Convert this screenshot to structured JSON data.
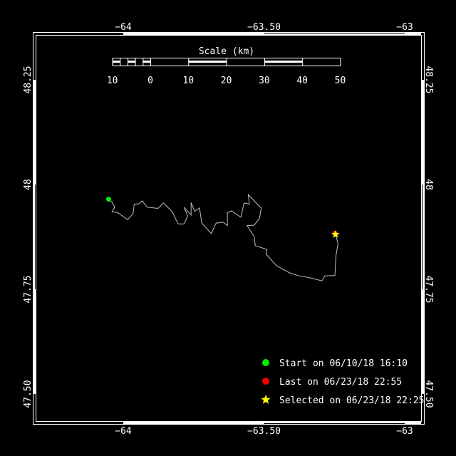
{
  "chart_data": {
    "type": "map-track",
    "lon_ticks": [
      -64,
      -63.5,
      -63
    ],
    "lon_tick_labels": [
      "−64",
      "−63.50",
      "−63"
    ],
    "lat_ticks": [
      48.25,
      48,
      47.75,
      47.5
    ],
    "lat_tick_labels": [
      "48.25",
      "48",
      "47.75",
      "47.50"
    ],
    "scale_bar": {
      "title": "Scale (km)",
      "ticks": [
        -10,
        0,
        10,
        20,
        30,
        40,
        50
      ],
      "tick_labels": [
        "10",
        "0",
        "10",
        "20",
        "30",
        "40",
        "50"
      ]
    },
    "track": {
      "color": "#c0c0c0",
      "points": [
        [
          -64.052,
          47.965
        ],
        [
          -64.041,
          47.959
        ],
        [
          -64.03,
          47.946
        ],
        [
          -64.04,
          47.935
        ],
        [
          -64.02,
          47.933
        ],
        [
          -63.984,
          47.916
        ],
        [
          -63.965,
          47.931
        ],
        [
          -63.961,
          47.953
        ],
        [
          -63.944,
          47.954
        ],
        [
          -63.933,
          47.961
        ],
        [
          -63.915,
          47.946
        ],
        [
          -63.877,
          47.943
        ],
        [
          -63.857,
          47.956
        ],
        [
          -63.826,
          47.935
        ],
        [
          -63.805,
          47.906
        ],
        [
          -63.784,
          47.906
        ],
        [
          -63.771,
          47.925
        ],
        [
          -63.784,
          47.946
        ],
        [
          -63.759,
          47.927
        ],
        [
          -63.759,
          47.957
        ],
        [
          -63.746,
          47.936
        ],
        [
          -63.729,
          47.944
        ],
        [
          -63.721,
          47.908
        ],
        [
          -63.687,
          47.883
        ],
        [
          -63.67,
          47.908
        ],
        [
          -63.645,
          47.91
        ],
        [
          -63.63,
          47.902
        ],
        [
          -63.63,
          47.933
        ],
        [
          -63.615,
          47.937
        ],
        [
          -63.582,
          47.922
        ],
        [
          -63.571,
          47.956
        ],
        [
          -63.552,
          47.953
        ],
        [
          -63.556,
          47.976
        ],
        [
          -63.535,
          47.961
        ],
        [
          -63.51,
          47.944
        ],
        [
          -63.516,
          47.919
        ],
        [
          -63.535,
          47.903
        ],
        [
          -63.56,
          47.902
        ],
        [
          -63.535,
          47.876
        ],
        [
          -63.531,
          47.854
        ],
        [
          -63.489,
          47.845
        ],
        [
          -63.493,
          47.834
        ],
        [
          -63.455,
          47.806
        ],
        [
          -63.408,
          47.789
        ],
        [
          -63.375,
          47.782
        ],
        [
          -63.341,
          47.778
        ],
        [
          -63.294,
          47.77
        ],
        [
          -63.284,
          47.782
        ],
        [
          -63.248,
          47.783
        ],
        [
          -63.244,
          47.831
        ],
        [
          -63.237,
          47.859
        ],
        [
          -63.246,
          47.881
        ]
      ]
    },
    "markers": {
      "start": {
        "lon": -64.052,
        "lat": 47.965,
        "color": "#00ee00"
      },
      "last": {
        "lon": -63.248,
        "lat": 47.884,
        "color": "#ee0000"
      },
      "selected": {
        "lon": -63.246,
        "lat": 47.881,
        "color": "#ffff00"
      }
    },
    "legend": {
      "position": "bottom-right",
      "items": [
        {
          "icon": "green-dot",
          "label": "Start on 06/10/18 16:10"
        },
        {
          "icon": "red-dot",
          "label": "Last on 06/23/18 22:55"
        },
        {
          "icon": "yellow-star",
          "label": "Selected on 06/23/18 22:25"
        }
      ]
    }
  }
}
